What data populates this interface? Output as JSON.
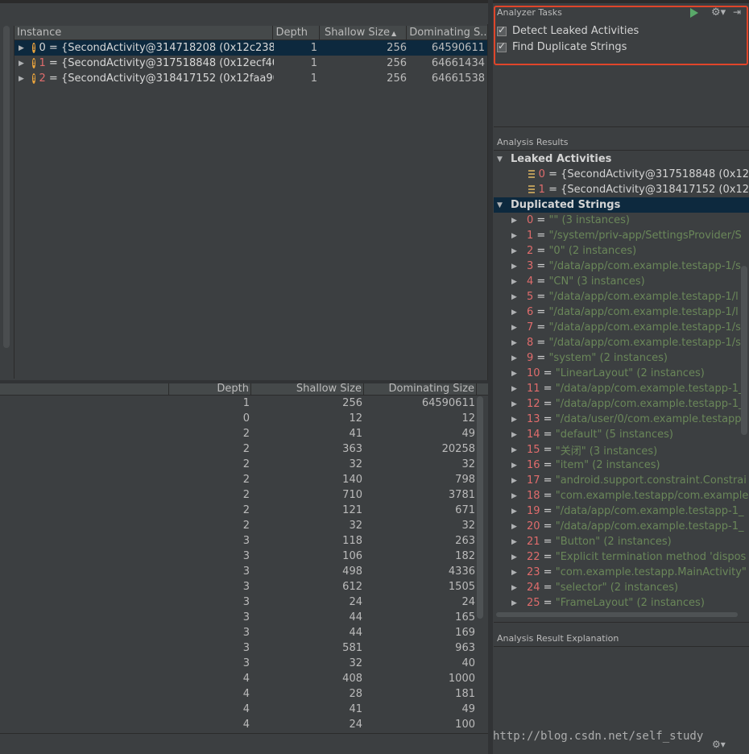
{
  "instances": {
    "columns": [
      "Instance",
      "Depth",
      "Shallow Size",
      "Dominating S..."
    ],
    "sort_indicator": "▲",
    "rows": [
      {
        "index": "0",
        "text": "{SecondActivity@314718208 (0x12c238(",
        "depth": "1",
        "shallow": "256",
        "dominating": "64590611",
        "selected": true
      },
      {
        "index": "1",
        "text": "{SecondActivity@317518848 (0x12ecf40",
        "depth": "1",
        "shallow": "256",
        "dominating": "64661434",
        "selected": false
      },
      {
        "index": "2",
        "text": "{SecondActivity@318417152 (0x12faa90",
        "depth": "1",
        "shallow": "256",
        "dominating": "64661538",
        "selected": false
      }
    ]
  },
  "references": {
    "columns": [
      "Depth",
      "Shallow Size",
      "Dominating Size"
    ],
    "rows": [
      [
        "1",
        "256",
        "64590611"
      ],
      [
        "0",
        "12",
        "12"
      ],
      [
        "2",
        "41",
        "49"
      ],
      [
        "2",
        "363",
        "20258"
      ],
      [
        "2",
        "32",
        "32"
      ],
      [
        "2",
        "140",
        "798"
      ],
      [
        "2",
        "710",
        "3781"
      ],
      [
        "2",
        "121",
        "671"
      ],
      [
        "2",
        "32",
        "32"
      ],
      [
        "3",
        "118",
        "263"
      ],
      [
        "3",
        "106",
        "182"
      ],
      [
        "3",
        "498",
        "4336"
      ],
      [
        "3",
        "612",
        "1505"
      ],
      [
        "3",
        "24",
        "24"
      ],
      [
        "3",
        "44",
        "165"
      ],
      [
        "3",
        "44",
        "169"
      ],
      [
        "3",
        "581",
        "963"
      ],
      [
        "3",
        "32",
        "40"
      ],
      [
        "4",
        "408",
        "1000"
      ],
      [
        "4",
        "28",
        "181"
      ],
      [
        "4",
        "41",
        "49"
      ],
      [
        "4",
        "24",
        "100"
      ]
    ]
  },
  "analyzer": {
    "title": "Analyzer Tasks",
    "tasks": [
      {
        "label": "Detect Leaked Activities",
        "checked": true
      },
      {
        "label": "Find Duplicate Strings",
        "checked": true
      }
    ]
  },
  "results": {
    "title": "Analysis Results",
    "leaked": {
      "label": "Leaked Activities",
      "items": [
        {
          "index": "0",
          "text": "{SecondActivity@317518848 (0x12"
        },
        {
          "index": "1",
          "text": "{SecondActivity@318417152 (0x12"
        }
      ]
    },
    "duplicates": {
      "label": "Duplicated Strings",
      "items": [
        {
          "index": "0",
          "text": "\"\" (3 instances)"
        },
        {
          "index": "1",
          "text": "\"/system/priv-app/SettingsProvider/S"
        },
        {
          "index": "2",
          "text": "\"0\" (2 instances)"
        },
        {
          "index": "3",
          "text": "\"/data/app/com.example.testapp-1/s"
        },
        {
          "index": "4",
          "text": "\"CN\" (3 instances)"
        },
        {
          "index": "5",
          "text": "\"/data/app/com.example.testapp-1/l"
        },
        {
          "index": "6",
          "text": "\"/data/app/com.example.testapp-1/l"
        },
        {
          "index": "7",
          "text": "\"/data/app/com.example.testapp-1/s"
        },
        {
          "index": "8",
          "text": "\"/data/app/com.example.testapp-1/s"
        },
        {
          "index": "9",
          "text": "\"system\" (2 instances)"
        },
        {
          "index": "10",
          "text": "\"LinearLayout\" (2 instances)"
        },
        {
          "index": "11",
          "text": "\"/data/app/com.example.testapp-1_"
        },
        {
          "index": "12",
          "text": "\"/data/app/com.example.testapp-1_"
        },
        {
          "index": "13",
          "text": "\"/data/user/0/com.example.testapp"
        },
        {
          "index": "14",
          "text": "\"default\" (5 instances)"
        },
        {
          "index": "15",
          "text": "\"关闭\" (3 instances)"
        },
        {
          "index": "16",
          "text": "\"item\" (2 instances)"
        },
        {
          "index": "17",
          "text": "\"android.support.constraint.Constrai"
        },
        {
          "index": "18",
          "text": "\"com.example.testapp/com.example"
        },
        {
          "index": "19",
          "text": "\"/data/app/com.example.testapp-1_"
        },
        {
          "index": "20",
          "text": "\"/data/app/com.example.testapp-1_"
        },
        {
          "index": "21",
          "text": "\"Button\" (2 instances)"
        },
        {
          "index": "22",
          "text": "\"Explicit termination method 'dispos"
        },
        {
          "index": "23",
          "text": "\"com.example.testapp.MainActivity\""
        },
        {
          "index": "24",
          "text": "\"selector\" (2 instances)"
        },
        {
          "index": "25",
          "text": "\"FrameLayout\" (2 instances)"
        }
      ]
    }
  },
  "explanation": {
    "title": "Analysis Result Explanation"
  },
  "watermark": "http://blog.csdn.net/self_study",
  "colors": {
    "accent_highlight": "#e0452a",
    "selection": "#0d293e",
    "string_green": "#6a8759",
    "index_red": "#e06c6c"
  }
}
